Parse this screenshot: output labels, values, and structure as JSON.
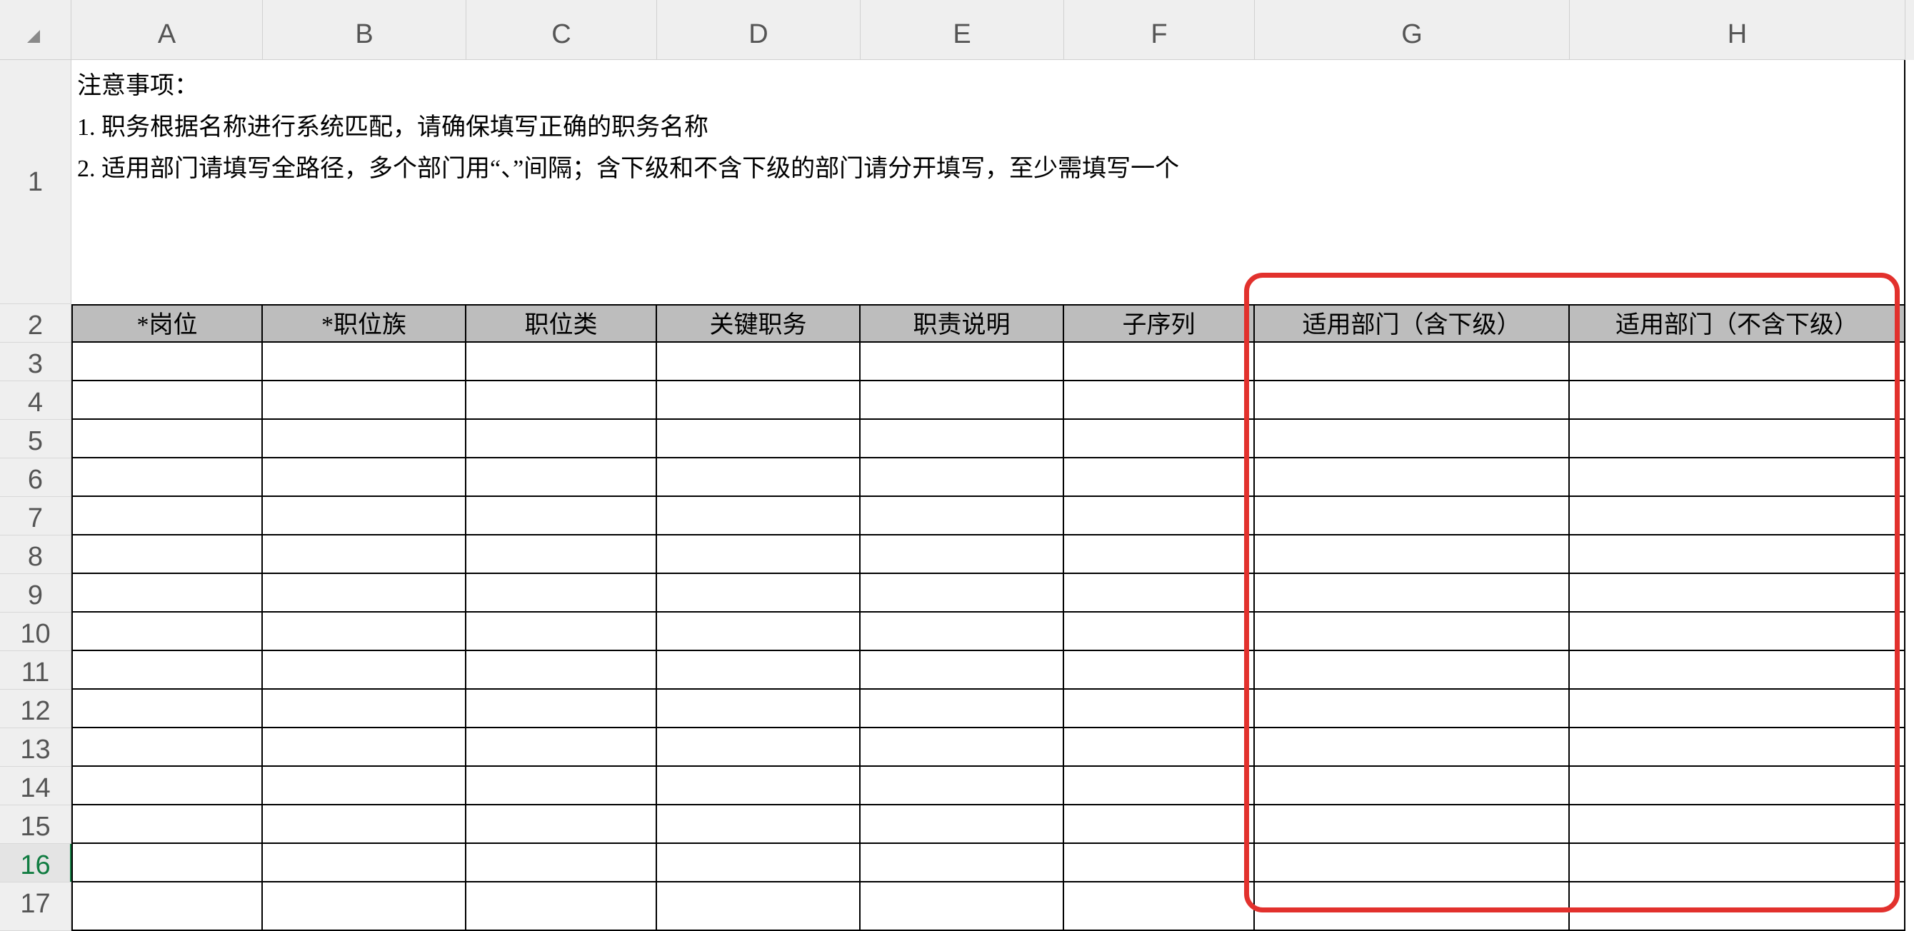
{
  "columns": [
    "A",
    "B",
    "C",
    "D",
    "E",
    "F",
    "G",
    "H"
  ],
  "rows": [
    "1",
    "2",
    "3",
    "4",
    "5",
    "6",
    "7",
    "8",
    "9",
    "10",
    "11",
    "12",
    "13",
    "14",
    "15",
    "16",
    "17"
  ],
  "active_row": "16",
  "notes": {
    "line1": "注意事项：",
    "line2": "1. 职务根据名称进行系统匹配，请确保填写正确的职务名称",
    "line3": "2. 适用部门请填写全路径，多个部门用“、”间隔；含下级和不含下级的部门请分开填写，至少需填写一个"
  },
  "headers": [
    "*岗位",
    "*职位族",
    "职位类",
    "关键职务",
    "职责说明",
    "子序列",
    "适用部门（含下级）",
    "适用部门（不含下级）"
  ],
  "colors": {
    "highlight": "#e2312d",
    "header_fill": "#bdbdbd",
    "active_row": "#107c41"
  }
}
